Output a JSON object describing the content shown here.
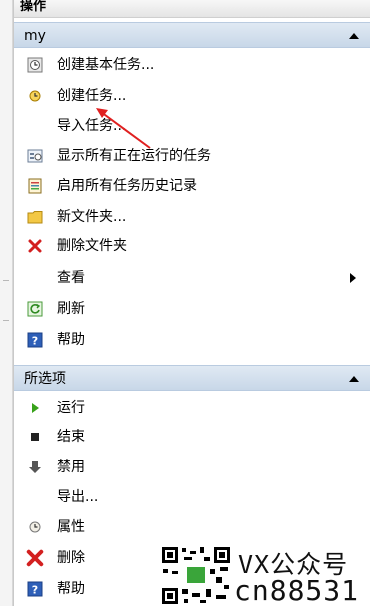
{
  "panel": {
    "title": "操作"
  },
  "sections": {
    "my": {
      "header": "my",
      "items": [
        {
          "label": "创建基本任务...",
          "icon": "task-wizard-icon"
        },
        {
          "label": "创建任务...",
          "icon": "create-task-icon"
        },
        {
          "label": "导入任务...",
          "icon": ""
        },
        {
          "label": "显示所有正在运行的任务",
          "icon": "running-tasks-icon"
        },
        {
          "label": "启用所有任务历史记录",
          "icon": "task-history-icon"
        },
        {
          "label": "新文件夹...",
          "icon": "folder-icon"
        },
        {
          "label": "删除文件夹",
          "icon": "delete-icon"
        },
        {
          "label": "查看",
          "icon": ""
        },
        {
          "label": "刷新",
          "icon": "refresh-icon"
        },
        {
          "label": "帮助",
          "icon": "help-icon"
        }
      ]
    },
    "selected": {
      "header": "所选项",
      "items": [
        {
          "label": "运行",
          "icon": "run-icon"
        },
        {
          "label": "结束",
          "icon": "stop-icon"
        },
        {
          "label": "禁用",
          "icon": "disable-icon"
        },
        {
          "label": "导出...",
          "icon": ""
        },
        {
          "label": "属性",
          "icon": "properties-icon"
        },
        {
          "label": "删除",
          "icon": "delete-icon"
        },
        {
          "label": "帮助",
          "icon": "help-icon"
        }
      ]
    }
  },
  "watermark": {
    "line1": "VX公众号",
    "line2": "cn88531"
  },
  "colors": {
    "section_bg": "#c8d7e8",
    "annotation_arrow": "#e02020"
  }
}
